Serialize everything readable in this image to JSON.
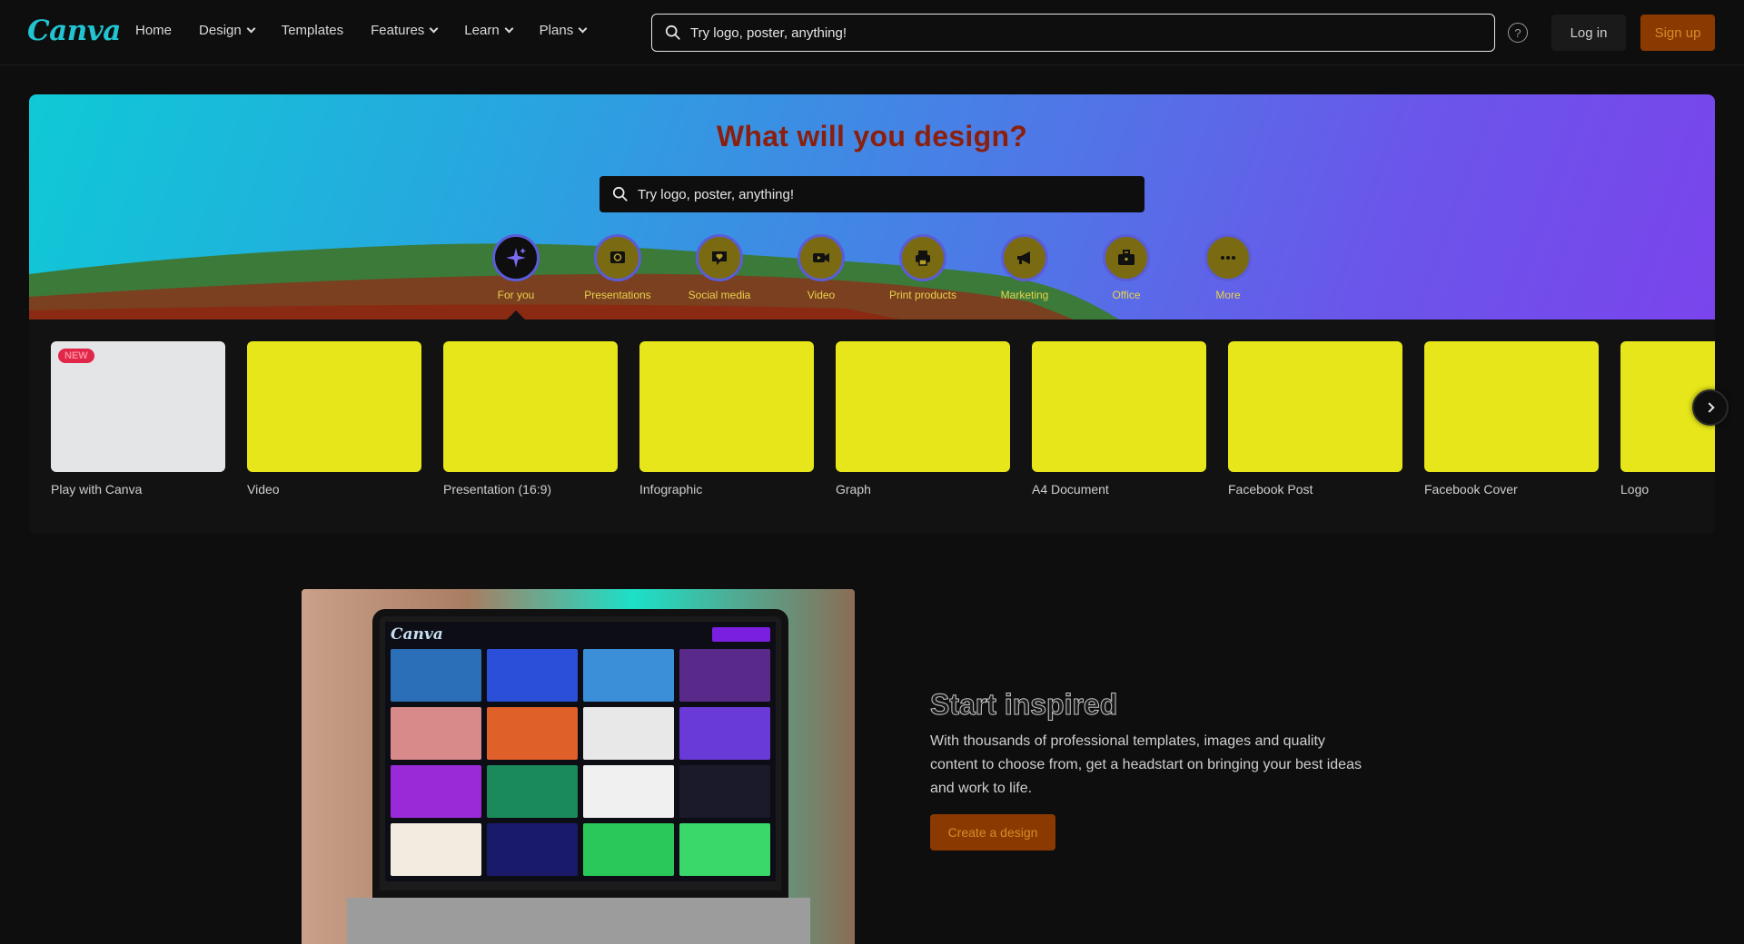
{
  "brand": {
    "logo_text": "Canva",
    "accent": "#21c4d1",
    "cta_bg": "#8a3a00",
    "cta_text": "#d88a2a"
  },
  "nav": {
    "items": [
      {
        "label": "Home",
        "has_menu": false
      },
      {
        "label": "Design",
        "has_menu": true
      },
      {
        "label": "Templates",
        "has_menu": false
      },
      {
        "label": "Features",
        "has_menu": true
      },
      {
        "label": "Learn",
        "has_menu": true
      },
      {
        "label": "Plans",
        "has_menu": true
      }
    ],
    "search_placeholder": "Try logo, poster, anything!",
    "help_icon": "help-icon",
    "login_label": "Log in",
    "signup_label": "Sign up"
  },
  "hero": {
    "title": "What will you design?",
    "search_placeholder": "Try logo, poster, anything!",
    "categories": [
      {
        "label": "For you",
        "icon": "sparkle-icon",
        "active": true
      },
      {
        "label": "Presentations",
        "icon": "presentation-icon",
        "active": false
      },
      {
        "label": "Social media",
        "icon": "heart-chat-icon",
        "active": false
      },
      {
        "label": "Video",
        "icon": "video-camera-icon",
        "active": false
      },
      {
        "label": "Print products",
        "icon": "printer-icon",
        "active": false
      },
      {
        "label": "Marketing",
        "icon": "megaphone-icon",
        "active": false
      },
      {
        "label": "Office",
        "icon": "briefcase-icon",
        "active": false
      },
      {
        "label": "More",
        "icon": "more-icon",
        "active": false
      }
    ]
  },
  "design_types": [
    {
      "label": "Play with Canva",
      "badge": "NEW"
    },
    {
      "label": "Video",
      "badge": ""
    },
    {
      "label": "Presentation (16:9)",
      "badge": ""
    },
    {
      "label": "Infographic",
      "badge": ""
    },
    {
      "label": "Graph",
      "badge": ""
    },
    {
      "label": "A4 Document",
      "badge": ""
    },
    {
      "label": "Facebook Post",
      "badge": ""
    },
    {
      "label": "Facebook Cover",
      "badge": ""
    },
    {
      "label": "Logo",
      "badge": ""
    }
  ],
  "inspire": {
    "title": "Start inspired",
    "body": "With thousands of professional templates, images and quality content to choose from, get a headstart on bringing your best ideas and work to life.",
    "cta_label": "Create a design",
    "laptop_logo": "Canva"
  }
}
